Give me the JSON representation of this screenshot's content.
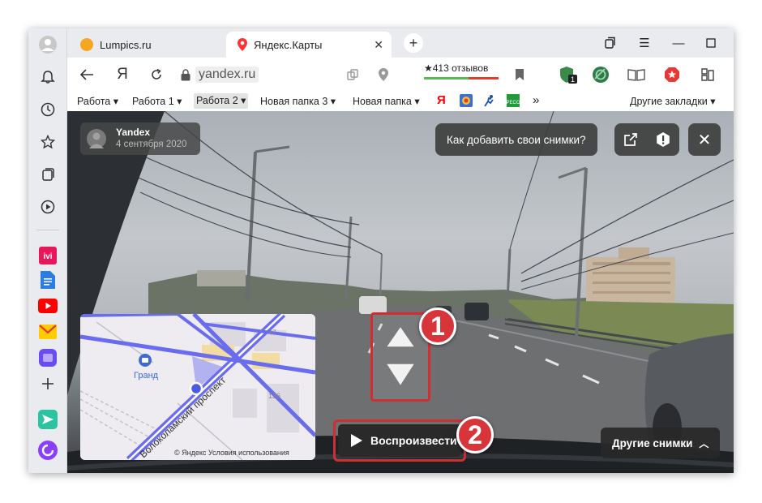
{
  "tabs": [
    {
      "title": "Lumpics.ru",
      "active": false,
      "favicon_color": "#f6a623"
    },
    {
      "title": "Яндекс.Карты",
      "active": true,
      "favicon_color": "#ff3333"
    }
  ],
  "toolbar": {
    "yandex_label": "Я",
    "url": "yandex.ru",
    "reviews_text": "★413 отзывов"
  },
  "bookmarks": {
    "items": [
      {
        "label": "Работа ▾"
      },
      {
        "label": "Работа 1 ▾"
      },
      {
        "label": "Работа 2 ▾"
      },
      {
        "label": "Новая папка 3 ▾"
      },
      {
        "label": "Новая папка ▾"
      }
    ],
    "yandex_mark": "Я",
    "more": "»",
    "other": "Другие закладки ▾"
  },
  "viewer": {
    "author_name": "Yandex",
    "author_date": "4 сентября 2020",
    "howto_label": "Как добавить свои снимки?",
    "play_label": "Воспроизвести",
    "other_label": "Другие снимки"
  },
  "minimap": {
    "place": "Гранд",
    "street": "Волоколамский проспект",
    "credit": "© Яндекс   Условия использования",
    "labels": [
      "47",
      "136"
    ]
  },
  "markers": [
    "1",
    "2"
  ],
  "colors": {
    "accent_red": "#cf2f33",
    "route_blue": "#6a6cf0"
  }
}
